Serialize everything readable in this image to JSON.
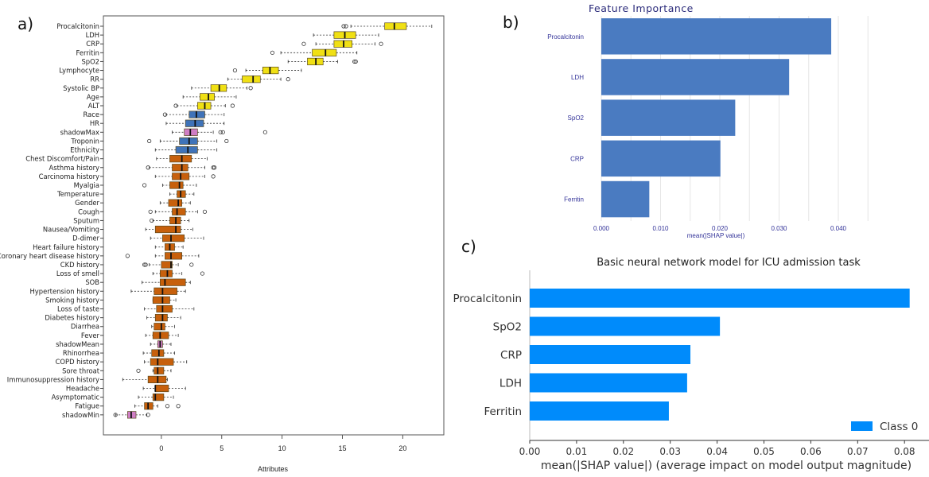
{
  "panels": {
    "a": "a)",
    "b": "b)",
    "c": "c)"
  },
  "chart_data": [
    {
      "id": "a",
      "type": "boxplot",
      "title": "",
      "xlabel": "Attributes",
      "ylabel": "",
      "xlim": [
        -4.8,
        23.4
      ],
      "xticks": [
        0,
        5,
        10,
        15,
        20
      ],
      "grid": false,
      "colors": {
        "confirmed": "#f0e014",
        "tentative": "#3f73b9",
        "rejected": "#c7600c",
        "shadow": "#cf7ec5"
      },
      "boxes": [
        {
          "label": "Procalcitonin",
          "group": "confirmed",
          "whislo": 15.7,
          "q1": 18.5,
          "med": 19.3,
          "q3": 20.3,
          "whishi": 22.4,
          "fliers": [
            15.1,
            15.3
          ]
        },
        {
          "label": "LDH",
          "group": "confirmed",
          "whislo": 12.6,
          "q1": 14.3,
          "med": 15.2,
          "q3": 16.1,
          "whishi": 18.0,
          "fliers": []
        },
        {
          "label": "CRP",
          "group": "confirmed",
          "whislo": 12.8,
          "q1": 14.3,
          "med": 15.1,
          "q3": 15.8,
          "whishi": 17.7,
          "fliers": [
            11.8,
            18.2
          ]
        },
        {
          "label": "Ferritin",
          "group": "confirmed",
          "whislo": 9.9,
          "q1": 12.5,
          "med": 13.6,
          "q3": 14.5,
          "whishi": 16.2,
          "fliers": [
            9.2
          ]
        },
        {
          "label": "SpO2",
          "group": "confirmed",
          "whislo": 10.5,
          "q1": 12.1,
          "med": 12.8,
          "q3": 13.4,
          "whishi": 14.6,
          "fliers": [
            16.0,
            16.1
          ]
        },
        {
          "label": "Lymphocyte",
          "group": "confirmed",
          "whislo": 7.0,
          "q1": 8.4,
          "med": 9.0,
          "q3": 9.7,
          "whishi": 11.6,
          "fliers": [
            6.1
          ]
        },
        {
          "label": "RR",
          "group": "confirmed",
          "whislo": 5.5,
          "q1": 6.7,
          "med": 7.6,
          "q3": 8.2,
          "whishi": 9.9,
          "fliers": [
            10.5
          ]
        },
        {
          "label": "Systolic BP",
          "group": "confirmed",
          "whislo": 2.5,
          "q1": 4.1,
          "med": 4.8,
          "q3": 5.4,
          "whishi": 7.1,
          "fliers": [
            7.4
          ]
        },
        {
          "label": "Age",
          "group": "confirmed",
          "whislo": 1.8,
          "q1": 3.2,
          "med": 3.9,
          "q3": 4.4,
          "whishi": 6.2,
          "fliers": []
        },
        {
          "label": "ALT",
          "group": "confirmed",
          "whislo": 1.3,
          "q1": 3.0,
          "med": 3.6,
          "q3": 4.1,
          "whishi": 5.3,
          "fliers": [
            1.2,
            5.9
          ]
        },
        {
          "label": "Race",
          "group": "tentative",
          "whislo": 0.4,
          "q1": 2.3,
          "med": 2.9,
          "q3": 3.6,
          "whishi": 5.2,
          "fliers": [
            0.3
          ]
        },
        {
          "label": "HR",
          "group": "tentative",
          "whislo": 0.4,
          "q1": 2.0,
          "med": 2.8,
          "q3": 3.5,
          "whishi": 5.2,
          "fliers": []
        },
        {
          "label": "shadowMax",
          "group": "shadow",
          "whislo": 0.9,
          "q1": 1.9,
          "med": 2.4,
          "q3": 3.0,
          "whishi": 4.3,
          "fliers": [
            4.9,
            5.1,
            8.6
          ]
        },
        {
          "label": "Troponin",
          "group": "tentative",
          "whislo": -0.1,
          "q1": 1.5,
          "med": 2.3,
          "q3": 3.0,
          "whishi": 4.6,
          "fliers": [
            -1.0,
            5.4
          ]
        },
        {
          "label": "Ethnicity",
          "group": "tentative",
          "whislo": -0.5,
          "q1": 1.2,
          "med": 2.2,
          "q3": 3.0,
          "whishi": 4.6,
          "fliers": []
        },
        {
          "label": "Chest Discomfort/Pain",
          "group": "rejected",
          "whislo": -0.4,
          "q1": 0.7,
          "med": 1.7,
          "q3": 2.5,
          "whishi": 3.8,
          "fliers": []
        },
        {
          "label": "Asthma history",
          "group": "rejected",
          "whislo": -1.0,
          "q1": 0.9,
          "med": 1.7,
          "q3": 2.2,
          "whishi": 3.6,
          "fliers": [
            -1.1,
            4.3,
            4.4
          ]
        },
        {
          "label": "Carcinoma history",
          "group": "rejected",
          "whislo": -0.5,
          "q1": 0.9,
          "med": 1.6,
          "q3": 2.3,
          "whishi": 3.6,
          "fliers": [
            4.3
          ]
        },
        {
          "label": "Myalgia",
          "group": "rejected",
          "whislo": 0.1,
          "q1": 0.7,
          "med": 1.5,
          "q3": 1.8,
          "whishi": 2.9,
          "fliers": [
            -1.4
          ]
        },
        {
          "label": "Temperature",
          "group": "rejected",
          "whislo": 0.7,
          "q1": 1.3,
          "med": 1.6,
          "q3": 2.0,
          "whishi": 2.7,
          "fliers": []
        },
        {
          "label": "Gender",
          "group": "rejected",
          "whislo": -0.1,
          "q1": 0.6,
          "med": 1.4,
          "q3": 1.7,
          "whishi": 2.4,
          "fliers": []
        },
        {
          "label": "Cough",
          "group": "rejected",
          "whislo": -0.5,
          "q1": 0.9,
          "med": 1.3,
          "q3": 2.0,
          "whishi": 3.0,
          "fliers": [
            -0.9,
            3.6
          ]
        },
        {
          "label": "Sputum",
          "group": "rejected",
          "whislo": -0.7,
          "q1": 0.7,
          "med": 1.2,
          "q3": 1.6,
          "whishi": 2.3,
          "fliers": [
            -0.8
          ]
        },
        {
          "label": "Nausea/Vomiting",
          "group": "rejected",
          "whislo": -1.3,
          "q1": -0.5,
          "med": 1.2,
          "q3": 1.6,
          "whishi": 2.6,
          "fliers": []
        },
        {
          "label": "D-dimer",
          "group": "rejected",
          "whislo": -0.9,
          "q1": 0.1,
          "med": 0.8,
          "q3": 1.9,
          "whishi": 3.5,
          "fliers": []
        },
        {
          "label": "Heart failure history",
          "group": "rejected",
          "whislo": -0.5,
          "q1": 0.3,
          "med": 0.7,
          "q3": 1.1,
          "whishi": 1.8,
          "fliers": []
        },
        {
          "label": "Coronary heart disease history",
          "group": "rejected",
          "whislo": -0.5,
          "q1": 0.3,
          "med": 0.8,
          "q3": 1.7,
          "whishi": 3.1,
          "fliers": [
            -2.8
          ]
        },
        {
          "label": "CKD history",
          "group": "rejected",
          "whislo": -1.0,
          "q1": 0.0,
          "med": 0.8,
          "q3": 0.9,
          "whishi": 1.4,
          "fliers": [
            -1.4,
            -1.3,
            2.5
          ]
        },
        {
          "label": "Loss of smell",
          "group": "rejected",
          "whislo": -0.7,
          "q1": -0.1,
          "med": 0.5,
          "q3": 0.9,
          "whishi": 1.7,
          "fliers": [
            3.4
          ]
        },
        {
          "label": "SOB",
          "group": "rejected",
          "whislo": -1.6,
          "q1": -0.1,
          "med": 0.3,
          "q3": 2.0,
          "whishi": 2.4,
          "fliers": []
        },
        {
          "label": "Hypertension history",
          "group": "rejected",
          "whislo": -2.5,
          "q1": -0.6,
          "med": 0.1,
          "q3": 1.3,
          "whishi": 2.0,
          "fliers": []
        },
        {
          "label": "Smoking history",
          "group": "rejected",
          "whislo": -0.7,
          "q1": -0.7,
          "med": 0.1,
          "q3": 0.7,
          "whishi": 1.2,
          "fliers": []
        },
        {
          "label": "Loss of taste",
          "group": "rejected",
          "whislo": -1.4,
          "q1": -0.4,
          "med": 0.1,
          "q3": 0.9,
          "whishi": 2.7,
          "fliers": []
        },
        {
          "label": "Diabetes history",
          "group": "rejected",
          "whislo": -1.2,
          "q1": -0.5,
          "med": 0.1,
          "q3": 0.5,
          "whishi": 1.6,
          "fliers": []
        },
        {
          "label": "Diarrhea",
          "group": "rejected",
          "whislo": -0.8,
          "q1": -0.6,
          "med": 0.0,
          "q3": 0.3,
          "whishi": 1.1,
          "fliers": []
        },
        {
          "label": "Fever",
          "group": "rejected",
          "whislo": -1.3,
          "q1": -0.7,
          "med": -0.1,
          "q3": 0.6,
          "whishi": 1.4,
          "fliers": []
        },
        {
          "label": "shadowMean",
          "group": "shadow",
          "whislo": -0.9,
          "q1": -0.3,
          "med": -0.1,
          "q3": 0.1,
          "whishi": 0.8,
          "fliers": []
        },
        {
          "label": "Rhinorrhea",
          "group": "rejected",
          "whislo": -1.5,
          "q1": -0.8,
          "med": -0.2,
          "q3": 0.2,
          "whishi": 1.1,
          "fliers": []
        },
        {
          "label": "COPD history",
          "group": "rejected",
          "whislo": -1.4,
          "q1": -0.9,
          "med": -0.3,
          "q3": 1.0,
          "whishi": 2.1,
          "fliers": []
        },
        {
          "label": "Sore throat",
          "group": "rejected",
          "whislo": -0.7,
          "q1": -0.6,
          "med": -0.3,
          "q3": 0.2,
          "whishi": 0.8,
          "fliers": [
            -1.9
          ]
        },
        {
          "label": "Immunosuppression history",
          "group": "rejected",
          "whislo": -3.2,
          "q1": -1.1,
          "med": -0.3,
          "q3": 0.4,
          "whishi": 0.5,
          "fliers": []
        },
        {
          "label": "Headache",
          "group": "rejected",
          "whislo": -1.5,
          "q1": -0.5,
          "med": -0.5,
          "q3": 0.6,
          "whishi": 2.0,
          "fliers": []
        },
        {
          "label": "Asymptomatic",
          "group": "rejected",
          "whislo": -1.9,
          "q1": -0.7,
          "med": -0.5,
          "q3": 0.2,
          "whishi": 1.0,
          "fliers": []
        },
        {
          "label": "Fatigue",
          "group": "rejected",
          "whislo": -2.2,
          "q1": -1.4,
          "med": -1.1,
          "q3": -0.7,
          "whishi": -0.3,
          "fliers": [
            0.5,
            1.4
          ]
        },
        {
          "label": "shadowMin",
          "group": "shadow",
          "whislo": -3.8,
          "q1": -2.8,
          "med": -2.5,
          "q3": -2.1,
          "whishi": -1.2,
          "fliers": [
            -3.8,
            -1.1
          ]
        }
      ]
    },
    {
      "id": "b",
      "type": "bar",
      "orientation": "horizontal",
      "title": "Feature Importance",
      "xlabel": "mean(|SHAP value|)",
      "ylabel": "",
      "categories": [
        "Procalcitonin",
        "LDH",
        "SpO2",
        "CRP",
        "Ferritin"
      ],
      "values": [
        0.0388,
        0.0317,
        0.0226,
        0.0201,
        0.0081
      ],
      "xlim": [
        0,
        0.0445
      ],
      "xticks": [
        0.0,
        0.01,
        0.02,
        0.03,
        0.04
      ],
      "xtick_labels": [
        "0.000",
        "0.010",
        "0.020",
        "0.030",
        "0.040"
      ],
      "grid": true,
      "bar_color": "#4a7bc1"
    },
    {
      "id": "c",
      "type": "bar",
      "orientation": "horizontal",
      "title": "Basic neural network model for ICU admission task",
      "xlabel": "mean(|SHAP value|) (average impact on model output magnitude)",
      "ylabel": "",
      "categories": [
        "Procalcitonin",
        "SpO2",
        "CRP",
        "LDH",
        "Ferritin"
      ],
      "series": [
        {
          "name": "Class 0",
          "values": [
            0.0811,
            0.0406,
            0.0343,
            0.0336,
            0.0297
          ]
        }
      ],
      "xlim": [
        0,
        0.0845
      ],
      "xticks": [
        0.0,
        0.01,
        0.02,
        0.03,
        0.04,
        0.05,
        0.06,
        0.07,
        0.08
      ],
      "xtick_labels": [
        "0.00",
        "0.01",
        "0.02",
        "0.03",
        "0.04",
        "0.05",
        "0.06",
        "0.07",
        "0.08"
      ],
      "grid": false,
      "legend": "bottom-right",
      "bar_color": "#008bfb"
    }
  ]
}
